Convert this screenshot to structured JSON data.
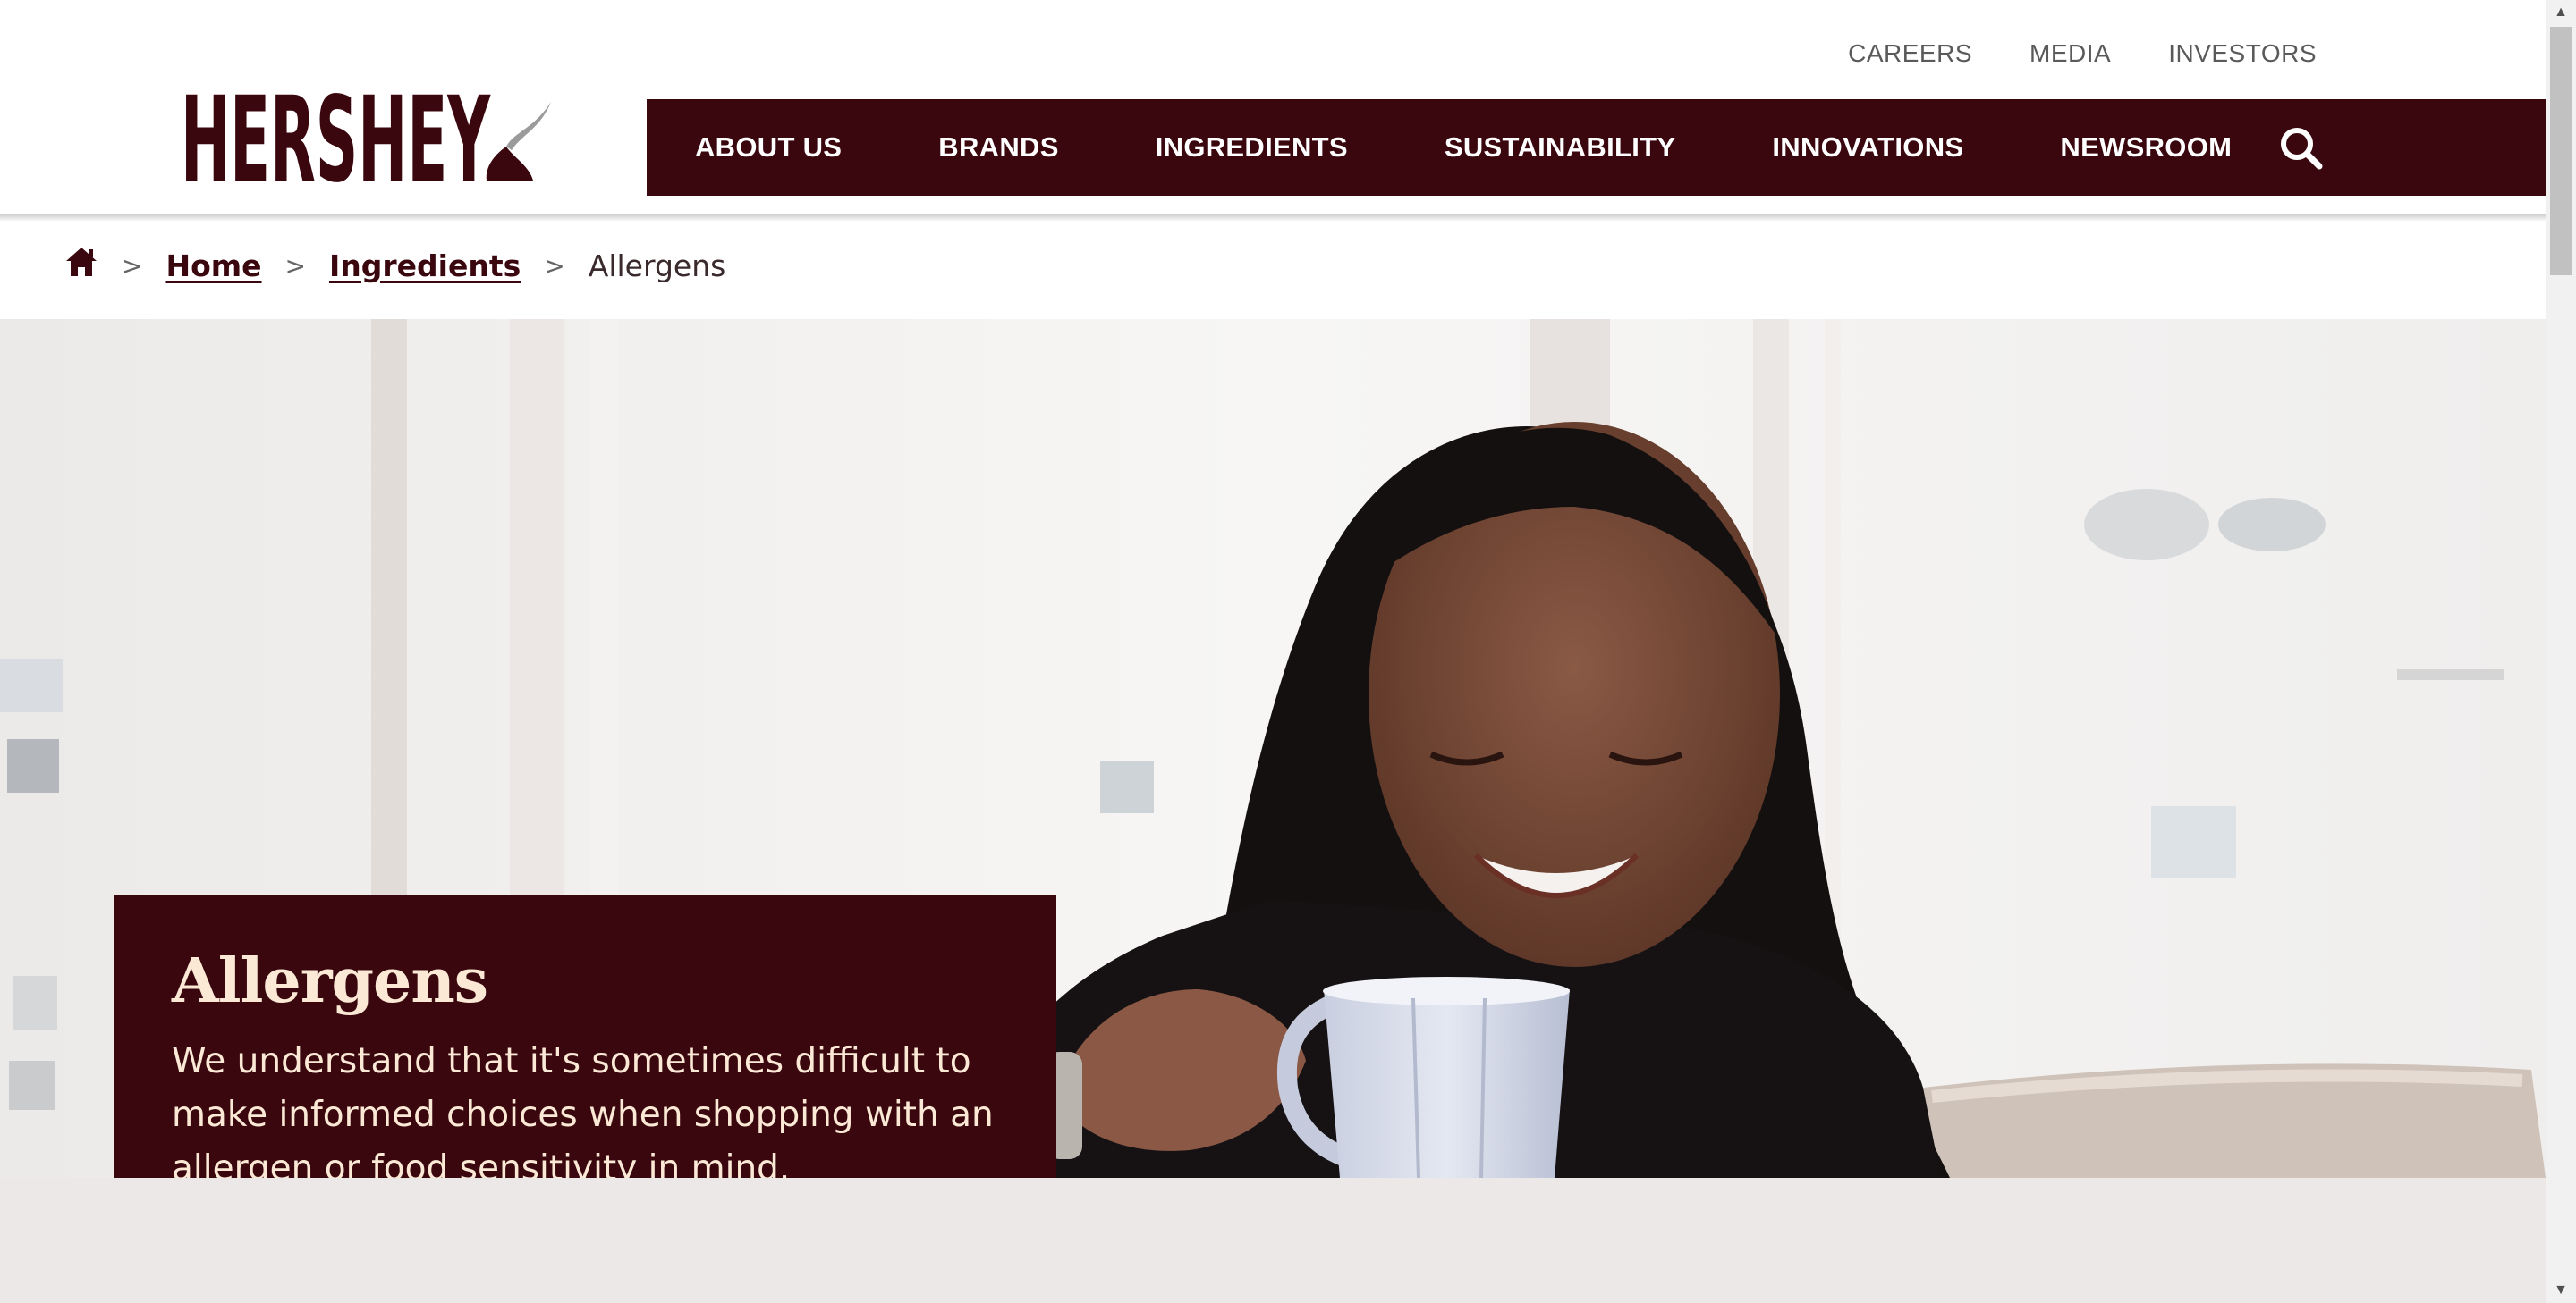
{
  "utility_nav": [
    "CAREERS",
    "MEDIA",
    "INVESTORS"
  ],
  "logo": {
    "text": "HERSHEY"
  },
  "main_nav": [
    "ABOUT US",
    "BRANDS",
    "INGREDIENTS",
    "SUSTAINABILITY",
    "INNOVATIONS",
    "NEWSROOM"
  ],
  "breadcrumb": {
    "home_icon": "home-icon",
    "separator": ">",
    "links": [
      "Home",
      "Ingredients"
    ],
    "current": "Allergens"
  },
  "hero": {
    "title": "Allergens",
    "description": "We understand that it's sometimes difficult to make informed choices when shopping with an allergen or food sensitivity in mind."
  },
  "colors": {
    "brand": "#3a070e",
    "hero_text": "#fbe9d6",
    "below_bg": "#ece8e7"
  },
  "icons": [
    "search-icon",
    "home-icon",
    "kiss-icon"
  ]
}
